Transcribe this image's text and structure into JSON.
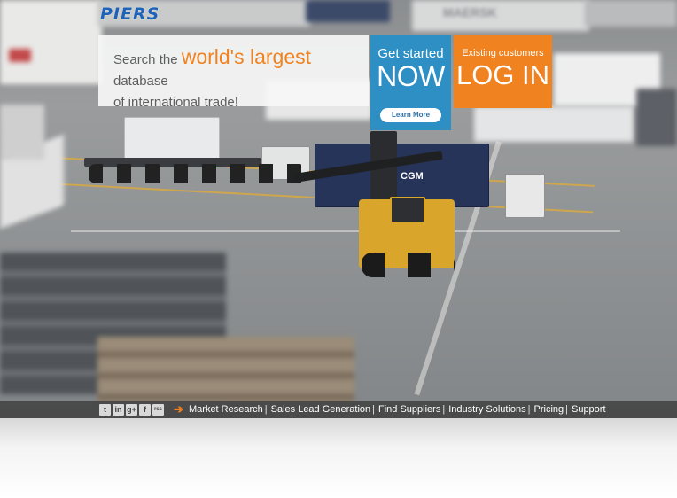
{
  "logo": {
    "text": "PIERS"
  },
  "tagline": {
    "prefix": "Search the ",
    "highlight": "world's largest",
    "suffix": " database",
    "line2": "of international trade!"
  },
  "cta_now": {
    "small": "Get started",
    "big": "NOW",
    "button": "Learn More",
    "color": "#2d8fc4"
  },
  "cta_login": {
    "small": "Existing customers",
    "big": "LOG IN",
    "color": "#f0821f"
  },
  "footer": {
    "social": [
      "t",
      "in",
      "g+",
      "f",
      "rss"
    ],
    "arrow": "➔",
    "links": [
      "Market Research",
      "Sales Lead Generation",
      "Find Suppliers",
      "Industry Solutions",
      "Pricing",
      "Support"
    ],
    "separator": "|"
  },
  "scene": {
    "container_text_maersk": "MAERSK",
    "container_text_cgm": "CGM"
  }
}
